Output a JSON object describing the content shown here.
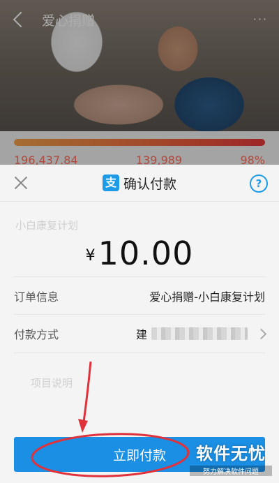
{
  "background": {
    "nav_title": "爱心捐赠",
    "more": "···",
    "stats": [
      "196,437.84",
      "139,989",
      "98%"
    ],
    "faint_texts": [
      "小白康复计划",
      "项目说明"
    ]
  },
  "sheet": {
    "title": "确认付款",
    "currency": "¥",
    "amount": "10.00",
    "help": "?",
    "alipay_glyph": "支",
    "rows": [
      {
        "label": "订单信息",
        "value": "爱心捐赠-小白康复计划"
      },
      {
        "label": "付款方式",
        "value": "建"
      }
    ]
  },
  "pay_button": {
    "label": "立即付款"
  },
  "watermark": {
    "main": "软件无忧",
    "sub": "努力解决软件问题"
  },
  "colors": {
    "accent": "#1b8fe4",
    "annotation": "#e0323a",
    "progress_end": "#e83a3a"
  },
  "icons": [
    "back-arrow-icon",
    "more-icon",
    "close-icon",
    "alipay-icon",
    "help-icon",
    "chevron-right-icon"
  ]
}
